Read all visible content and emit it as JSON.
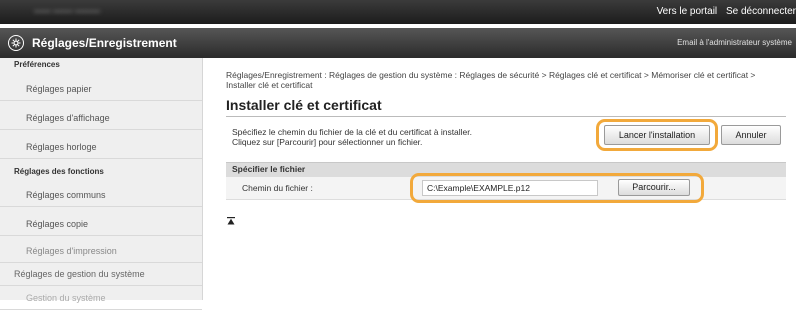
{
  "topbar": {
    "device_name": "•••••• ••••••• •••••••••",
    "portal_link": "Vers le portail",
    "logout_link": "Se déconnecter"
  },
  "header": {
    "title": "Réglages/Enregistrement",
    "email_link": "Email à l'administrateur système"
  },
  "sidebar": {
    "preferences_heading": "Préférences",
    "items": [
      {
        "label": "Réglages papier"
      },
      {
        "label": "Réglages d'affichage"
      },
      {
        "label": "Réglages horloge"
      }
    ],
    "functions_heading": "Réglages des fonctions",
    "function_items": [
      {
        "label": "Réglages communs"
      },
      {
        "label": "Réglages copie"
      },
      {
        "label": "Réglages d'impression"
      }
    ],
    "system_item": "Réglages de gestion du système",
    "system_sub_item": "Gestion du système"
  },
  "main": {
    "breadcrumb": "Réglages/Enregistrement : Réglages de gestion du système : Réglages de sécurité > Réglages clé et certificat > Mémoriser clé et certificat > Installer clé et certificat",
    "title": "Installer clé et certificat",
    "description_line1": "Spécifiez le chemin du fichier de la clé et du certificat à installer.",
    "description_line2": "Cliquez sur [Parcourir] pour sélectionner un fichier.",
    "start_button": "Lancer l'installation",
    "cancel_button": "Annuler",
    "section_title": "Spécifier le fichier",
    "file_path_label": "Chemin du fichier :",
    "file_path_value": "C:\\Example\\EXAMPLE.p12",
    "browse_button": "Parcourir..."
  },
  "colors": {
    "highlight": "#f2a93b",
    "header": "#3a3a3a",
    "sidebar": "#efefef"
  }
}
